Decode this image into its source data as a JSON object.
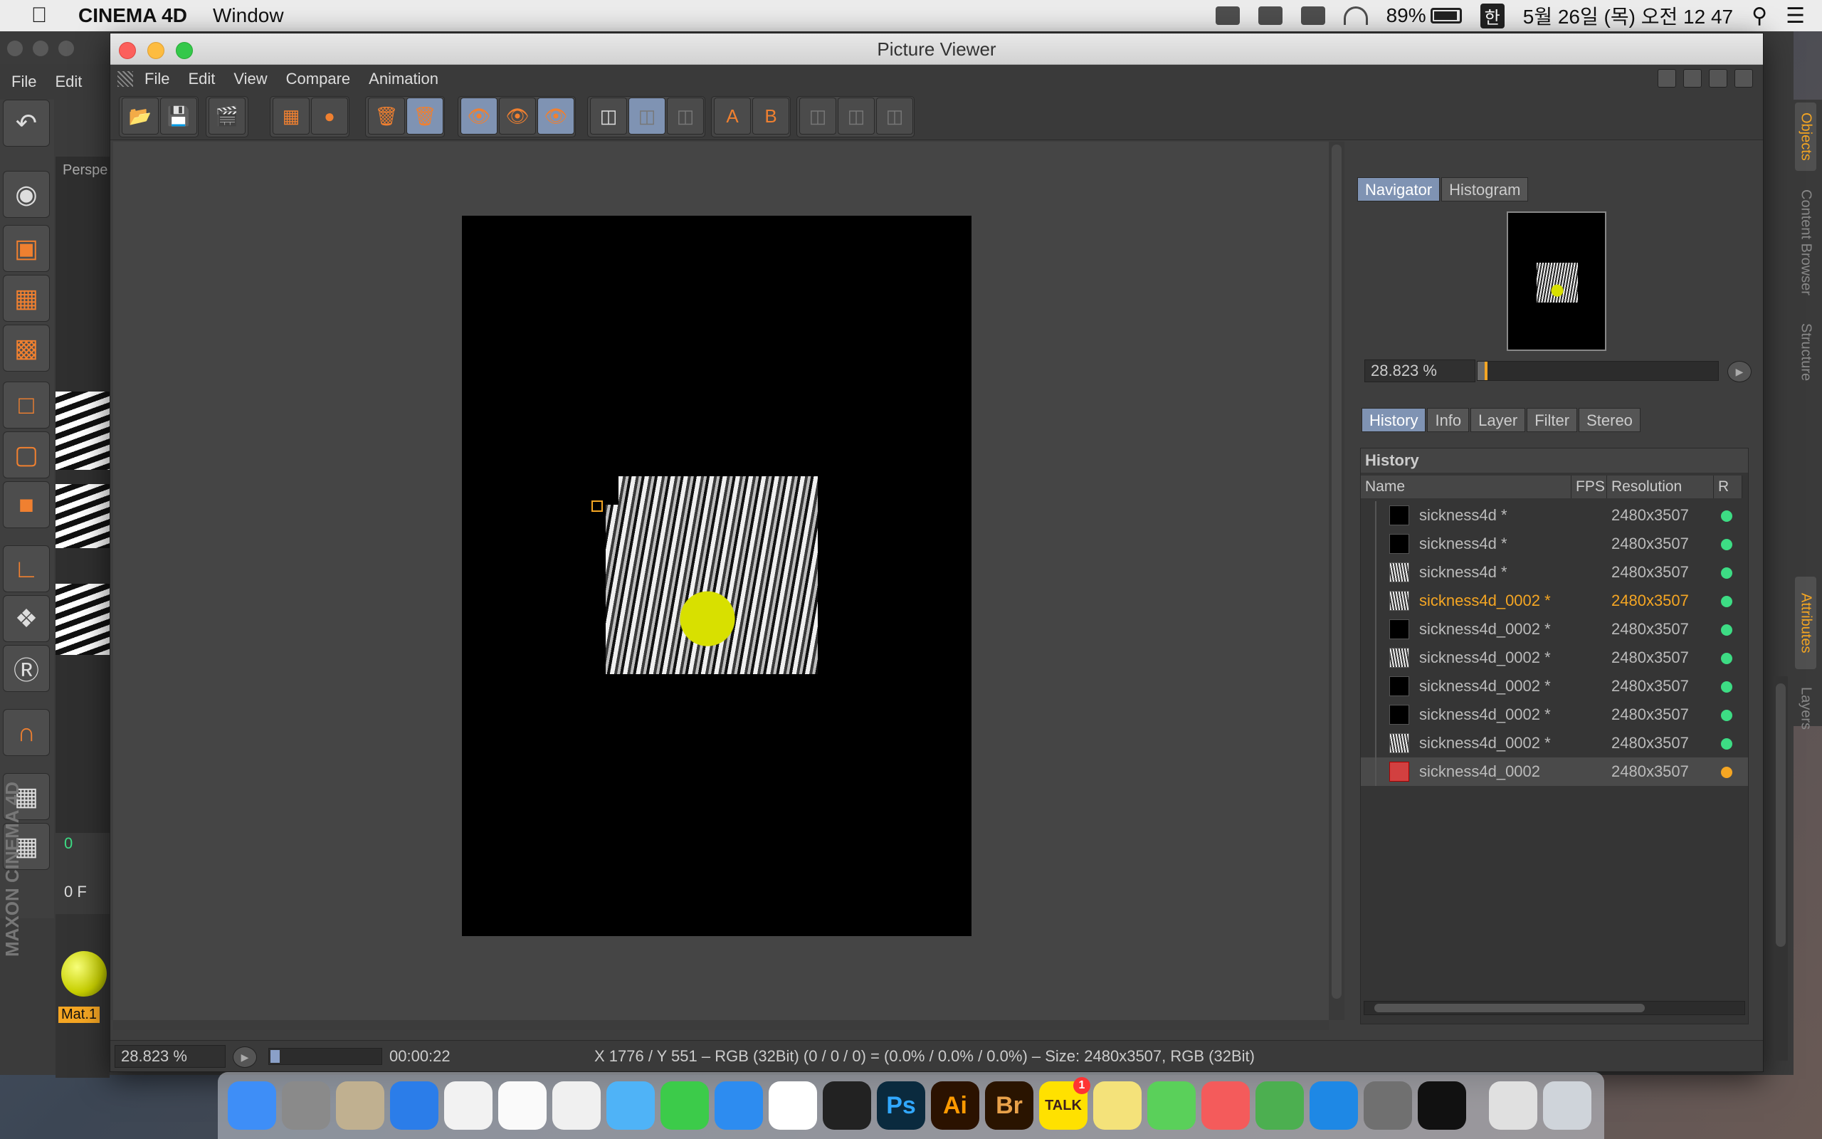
{
  "menubar": {
    "app": "CINEMA 4D",
    "items": [
      "Window"
    ],
    "battery": "89%",
    "input": "한",
    "clock": "5월 26일 (목) 오전 12 47"
  },
  "c4d": {
    "menu": [
      "File",
      "Edit"
    ],
    "viewport_label": "Perspe",
    "frame": "0",
    "frame2": "0 F",
    "material": "Mat.1",
    "brand": "MAXON CINEMA 4D",
    "tabs_right": [
      "Objects",
      "Content Browser",
      "Structure",
      "Attributes",
      "Layers"
    ]
  },
  "window": {
    "title": "Picture Viewer",
    "menu": [
      "File",
      "Edit",
      "View",
      "Compare",
      "Animation"
    ]
  },
  "navigator": {
    "tabs": [
      "Navigator",
      "Histogram"
    ],
    "zoom": "28.823 %",
    "zoom_fraction": 0.29
  },
  "history": {
    "tabs": [
      "History",
      "Info",
      "Layer",
      "Filter",
      "Stereo"
    ],
    "title": "History",
    "columns": [
      "Name",
      "FPS",
      "Resolution",
      "R"
    ],
    "rows": [
      {
        "name": "sickness4d *",
        "res": "2480x3507",
        "status": "ok"
      },
      {
        "name": "sickness4d *",
        "res": "2480x3507",
        "status": "ok"
      },
      {
        "name": "sickness4d *",
        "res": "2480x3507",
        "status": "ok"
      },
      {
        "name": "sickness4d_0002 *",
        "res": "2480x3507",
        "status": "ok",
        "selected": true
      },
      {
        "name": "sickness4d_0002 *",
        "res": "2480x3507",
        "status": "ok"
      },
      {
        "name": "sickness4d_0002 *",
        "res": "2480x3507",
        "status": "ok"
      },
      {
        "name": "sickness4d_0002 *",
        "res": "2480x3507",
        "status": "ok"
      },
      {
        "name": "sickness4d_0002 *",
        "res": "2480x3507",
        "status": "ok"
      },
      {
        "name": "sickness4d_0002 *",
        "res": "2480x3507",
        "status": "ok"
      },
      {
        "name": "sickness4d_0002",
        "res": "2480x3507",
        "status": "rendering"
      }
    ],
    "status_colors": {
      "ok": "#3ddc84",
      "rendering": "#f5a623"
    }
  },
  "status": {
    "zoom": "28.823 %",
    "progress_fraction": 0.08,
    "time": "00:00:22",
    "info": "X 1776 / Y 551 – RGB (32Bit) (0 / 0 / 0) = (0.0% / 0.0% / 0.0%) – Size: 2480x3507, RGB (32Bit)"
  },
  "dock": [
    "finder-icon",
    "launchpad-icon",
    "fontbook-icon",
    "safari-icon",
    "notes-icon",
    "reminders-icon",
    "photos-icon",
    "messages-icon",
    "facetime-icon",
    "appstore-icon",
    "chrome-icon",
    "cinema4d-icon",
    "photoshop-icon",
    "illustrator-icon",
    "bridge-icon",
    "kakaotalk-icon",
    "stickies-icon",
    "paper-plane-icon",
    "colorsync-icon",
    "evernote-icon",
    "shazam-icon",
    "system-preferences-icon",
    "terminal-icon",
    "archive-icon",
    "trash-icon"
  ],
  "dock_labels": {
    "photoshop": "Ps",
    "illustrator": "Ai",
    "bridge": "Br",
    "kakaotalk": "TALK",
    "kakaotalk_badge": "1"
  }
}
